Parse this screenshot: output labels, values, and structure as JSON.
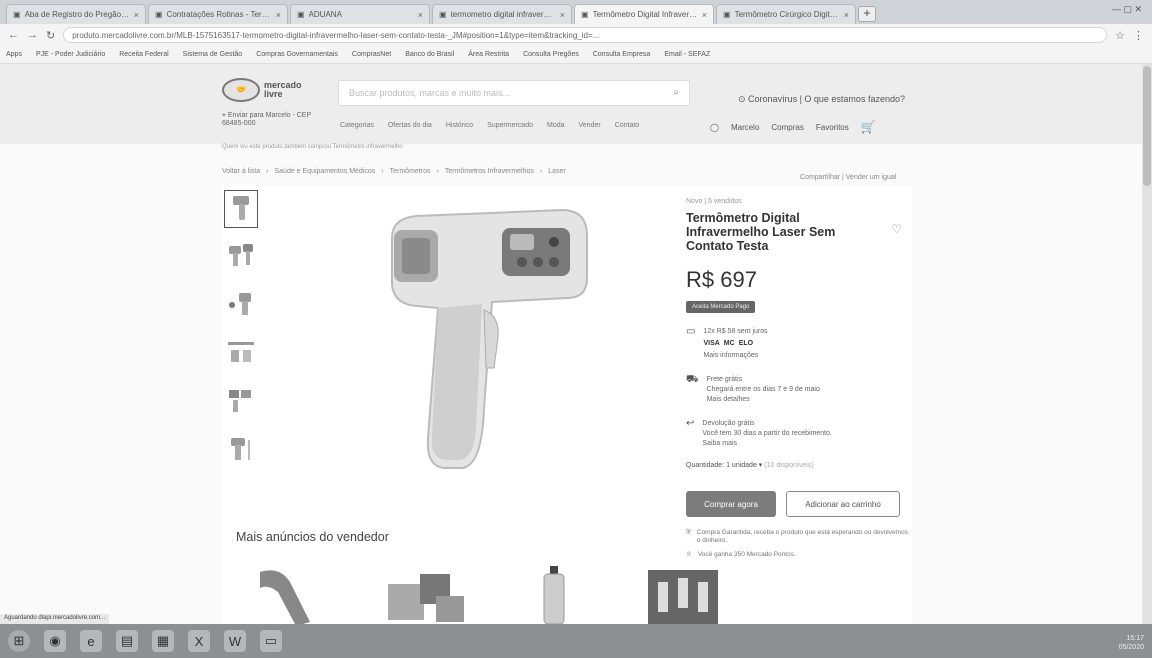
{
  "browser": {
    "tabs": [
      {
        "label": "Aba de Registro do Pregão - PE...",
        "active": false
      },
      {
        "label": "Contratações Rotinas - Termômetro...",
        "active": false
      },
      {
        "label": "ADUANA",
        "active": false
      },
      {
        "label": "termometro digital infravermelho - Google",
        "active": false
      },
      {
        "label": "Termômetro Digital Infravermelho...",
        "active": true
      },
      {
        "label": "Termômetro Cirúrgico Digital...",
        "active": false
      }
    ],
    "url": "produto.mercadolivre.com.br/MLB-1575163517-termometro-digital-infravermelho-laser-sem-contato-testa-_JM#position=1&type=item&tracking_id=...",
    "bookmarks": [
      "Apps",
      "PJE - Poder Judiciário",
      "Receita Federal",
      "Sistema de Gestão",
      "Compras Governamentais",
      "ComprasNet",
      "Banco do Brasil",
      "Área Restrita",
      "Consulta Pregões",
      "Consulta Empresa",
      "Email - SEFAZ"
    ]
  },
  "header": {
    "logo": "mercado livre",
    "search_placeholder": "Buscar produtos, marcas e muito mais...",
    "promo": "Coronavírus | O que estamos fazendo?",
    "cep": "Enviar para Marcelo - CEP 68485-000",
    "nav": [
      "Categorias",
      "Ofertas do dia",
      "Histórico",
      "Supermercado",
      "Moda",
      "Vender",
      "Contato"
    ],
    "user_nav": [
      "Marcelo",
      "Compras",
      "Favoritos"
    ]
  },
  "breadcrumb_top": "Quem viu este produto também comprou Termômetro infravermelho",
  "breadcrumb": [
    "Voltar à lista",
    "Saúde e Equipamentos Médicos",
    "Termômetros",
    "Termômetros Infravermelhos",
    "Laser"
  ],
  "breadcrumb_right": "Compartilhar | Vender um igual",
  "product": {
    "condition": "Novo  |  5 vendidos",
    "title": "Termômetro Digital Infravermelho Laser Sem Contato Testa",
    "price": "R$ 697",
    "tag": "Aceita Mercado Pago",
    "payment": {
      "line1": "12x R$ 58 sem juros",
      "brands": [
        "VISA",
        "MC",
        "ELO"
      ],
      "more": "Mais informações"
    },
    "shipping": {
      "line1": "Frete grátis",
      "line2": "Chegará entre os dias 7 e 9 de maio",
      "more": "Mais detalhes"
    },
    "returns": {
      "line1": "Devolução grátis",
      "line2": "Você tem 30 dias a partir do recebimento.",
      "more": "Saiba mais"
    },
    "quantity": "Quantidade: 1 unidade",
    "stock": "(10 disponíveis)",
    "buy_label": "Comprar agora",
    "cart_label": "Adicionar ao carrinho",
    "protection": "Compra Garantida, receba o produto que está esperando ou devolvemos o dinheiro.",
    "points": "Você ganha 350 Mercado Pontos."
  },
  "more_title": "Mais anúncios do vendedor",
  "status_text": "Aguardando dlapi.mercadolivre.com...",
  "tray": {
    "time": "15:17",
    "date": "05/2020"
  }
}
